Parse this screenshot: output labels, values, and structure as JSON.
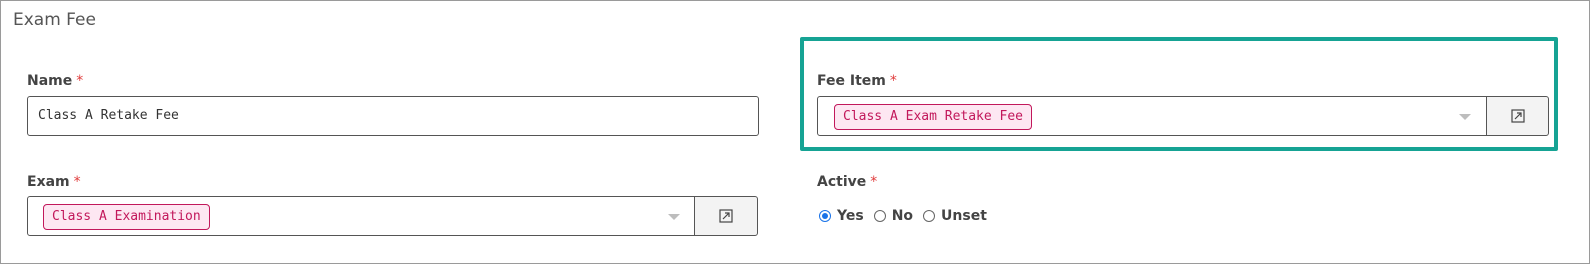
{
  "panel": {
    "title": "Exam Fee"
  },
  "required_marker": "*",
  "fields": {
    "name": {
      "label": "Name",
      "value": "Class A Retake Fee"
    },
    "fee_item": {
      "label": "Fee Item",
      "tag": "Class A Exam Retake Fee"
    },
    "exam": {
      "label": "Exam",
      "tag": "Class A Examination"
    },
    "active": {
      "label": "Active",
      "options": [
        "Yes",
        "No",
        "Unset"
      ],
      "selected": "Yes"
    }
  },
  "colors": {
    "highlight": "#16a394",
    "tag_border": "#c2185b",
    "tag_background": "#fde7f2",
    "required": "#e03b3b",
    "radio_selected": "#1a73e8"
  },
  "icons": {
    "open_link": "external-link-icon",
    "dropdown": "chevron-down-icon"
  }
}
